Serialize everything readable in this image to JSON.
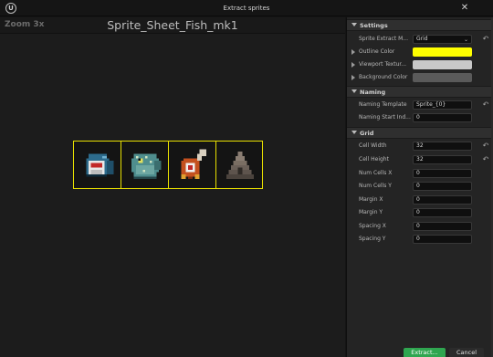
{
  "window": {
    "title": "Extract sprites",
    "logo_letter": "U",
    "close_glyph": "✕"
  },
  "preview": {
    "zoom_label": "Zoom 3x",
    "asset_name": "Sprite_Sheet_Fish_mk1",
    "outline_color": "#e8e000",
    "sprites": [
      {
        "icon": "fish-mask-icon"
      },
      {
        "icon": "pufferfish-icon"
      },
      {
        "icon": "meat-bone-icon"
      },
      {
        "icon": "shark-fin-icon"
      }
    ]
  },
  "settings": {
    "title": "Settings",
    "sprite_extract_mode": {
      "label": "Sprite Extract M...",
      "value": "Grid"
    },
    "outline_color": {
      "label": "Outline Color",
      "color": "#ffff00"
    },
    "viewport_texture": {
      "label": "Viewport Textur...",
      "color": "#c8c8c8"
    },
    "background_color": {
      "label": "Background Color",
      "color": "#5a5a5a"
    }
  },
  "naming": {
    "title": "Naming",
    "template": {
      "label": "Naming Template",
      "value": "Sprite_{0}"
    },
    "start_index": {
      "label": "Naming Start Ind...",
      "value": "0"
    }
  },
  "grid": {
    "title": "Grid",
    "cell_width": {
      "label": "Cell Width",
      "value": "32"
    },
    "cell_height": {
      "label": "Cell Height",
      "value": "32"
    },
    "num_cells_x": {
      "label": "Num Cells X",
      "value": "0"
    },
    "num_cells_y": {
      "label": "Num Cells Y",
      "value": "0"
    },
    "margin_x": {
      "label": "Margin X",
      "value": "0"
    },
    "margin_y": {
      "label": "Margin Y",
      "value": "0"
    },
    "spacing_x": {
      "label": "Spacing X",
      "value": "0"
    },
    "spacing_y": {
      "label": "Spacing Y",
      "value": "0"
    }
  },
  "buttons": {
    "extract": "Extract...",
    "cancel": "Cancel"
  },
  "reset_glyph": "↶",
  "dropdown_glyph": "⌄"
}
